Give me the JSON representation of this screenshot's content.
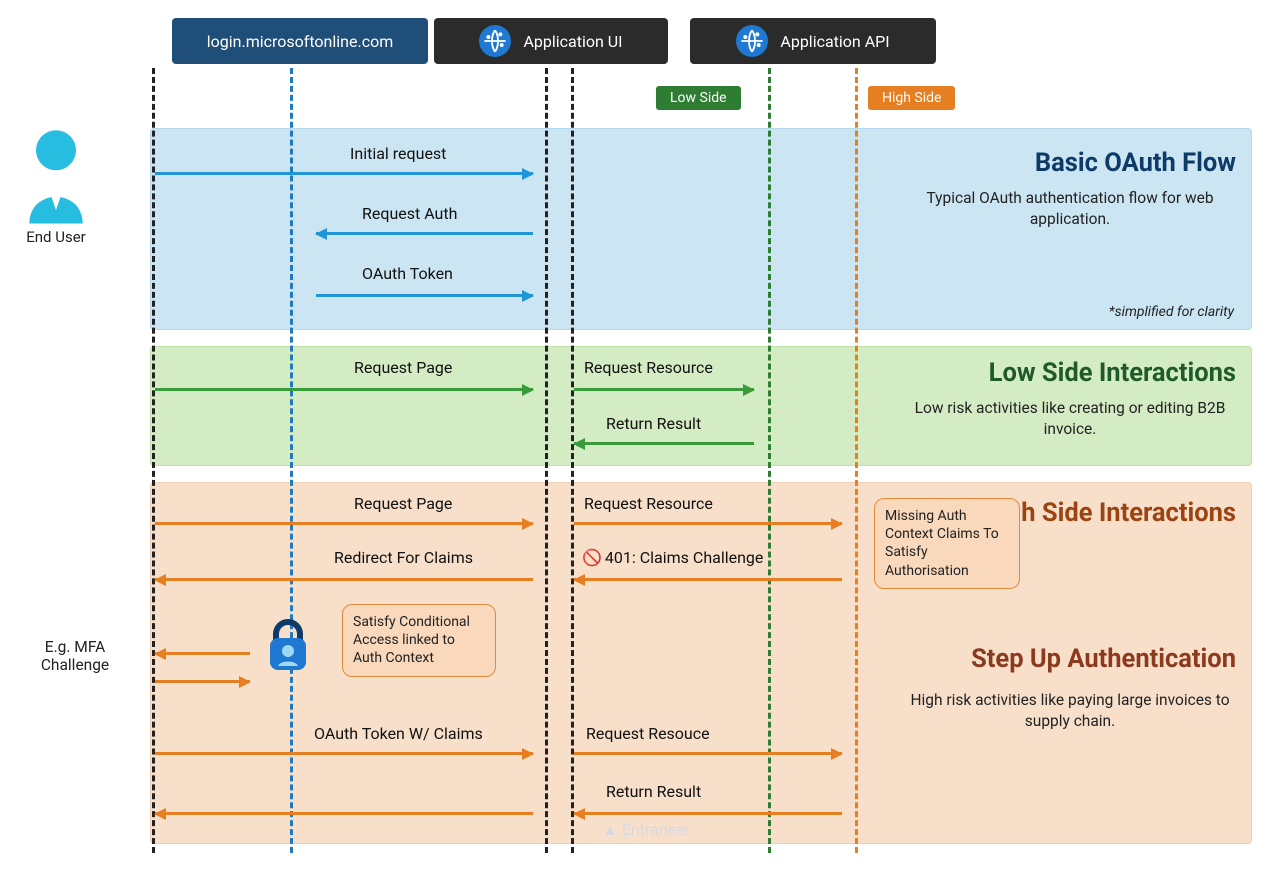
{
  "actors": {
    "end_user": "End User",
    "login": "login.microsoftonline.com",
    "ui": "Application UI",
    "api": "Application API"
  },
  "badges": {
    "low": "Low Side",
    "high": "High Side"
  },
  "sections": {
    "oauth": {
      "title": "Basic OAuth Flow",
      "desc": "Typical OAuth authentication flow for web application.",
      "note": "*simplified for clarity",
      "messages": {
        "initial_request": "Initial request",
        "request_auth": "Request Auth",
        "oauth_token": "OAuth Token"
      }
    },
    "low": {
      "title": "Low Side Interactions",
      "desc": "Low risk activities like creating or editing B2B invoice.",
      "messages": {
        "request_page": "Request Page",
        "request_resource": "Request Resource",
        "return_result": "Return Result"
      }
    },
    "high": {
      "title_top": "High Side Interactions",
      "title_mid": "Step Up Authentication",
      "desc": "High risk activities like paying large invoices to supply chain.",
      "left_label": "E.g. MFA Challenge",
      "messages": {
        "request_page": "Request Page",
        "request_resource_1": "Request Resource",
        "claims_challenge": "401: Claims Challenge",
        "redirect_for_claims": "Redirect For Claims",
        "oauth_token_claims": "OAuth Token W/ Claims",
        "request_resource_2": "Request Resouce",
        "return_result": "Return Result"
      },
      "callouts": {
        "conditional_access": "Satisfy Conditional Access linked to Auth Context",
        "missing_claims": "Missing Auth Context Claims To Satisfy Authorisation"
      }
    }
  },
  "watermark": "Entraneer"
}
